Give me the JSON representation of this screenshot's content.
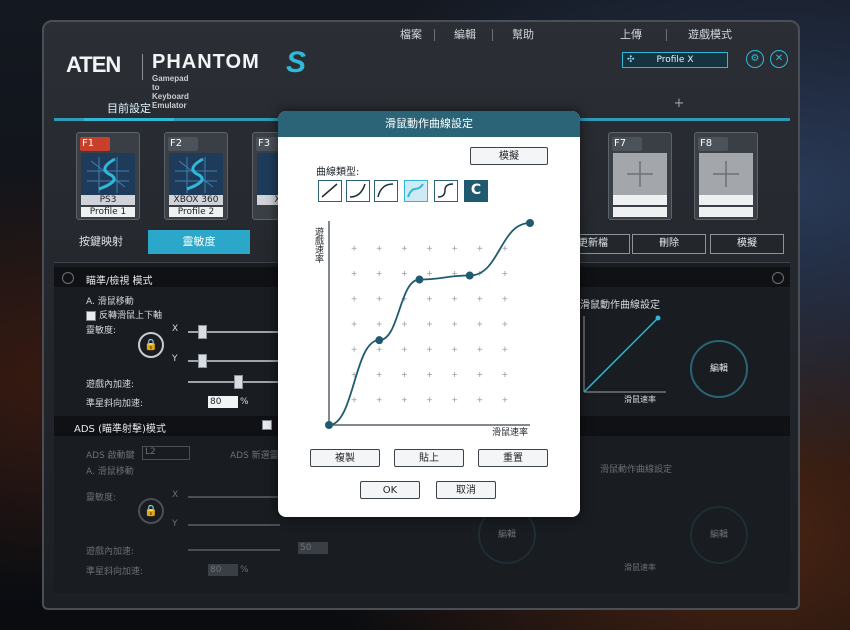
{
  "menu": {
    "file": "檔案",
    "edit": "編輯",
    "help": "幫助",
    "upload": "上傳",
    "game_mode": "遊戲模式"
  },
  "logo": {
    "brand": "ATEN",
    "product": "PHANTOM",
    "subtitle": "Gamepad to Keyboard Emulator",
    "mark": "S"
  },
  "profile_select": {
    "value": "Profile X"
  },
  "tabs": {
    "current": "目前設定",
    "add": "+"
  },
  "profiles": [
    {
      "key": "F1",
      "line1": "PS3",
      "line2": "Profile 1"
    },
    {
      "key": "F2",
      "line1": "XBOX 360",
      "line2": "Profile 2"
    },
    {
      "key": "F3",
      "line1": "XBO",
      "line2": ""
    },
    {
      "key": "F7",
      "line1": "",
      "line2": ""
    },
    {
      "key": "F8",
      "line1": "",
      "line2": ""
    }
  ],
  "nav": {
    "key_mapping": "按鍵映射",
    "sensitivity": "靈敏度"
  },
  "actions": {
    "update": "更新檔",
    "delete": "刪除",
    "simulate": "模擬"
  },
  "aim_section": {
    "title": "瞄準/檢視 模式",
    "mouse_move": "A. 滑鼠移動",
    "invert": "反轉滑鼠上下軸",
    "sensitivity": "靈敏度:",
    "x": "X",
    "y": "Y",
    "in_game_accel": "遊戲內加速:",
    "diag_accel": "準星斜向加速:",
    "diag_value": "80",
    "percent": "%",
    "curve_title": "滑鼠動作曲線設定",
    "y_axis_short": "遊戲速率",
    "x_axis": "滑鼠速率",
    "edit": "編輯"
  },
  "ads_section": {
    "title": "ADS (瞄準射擊)模式",
    "trigger": "ADS 啟動鍵",
    "trigger_value": "L2",
    "new_sens": "ADS 新選靈敏度",
    "mouse_move": "A. 滑鼠移動",
    "sensitivity": "靈敏度:",
    "x": "X",
    "y": "Y",
    "in_game_accel": "遊戲內加速:",
    "accel_value": "50",
    "diag_accel": "準星斜向加速:",
    "diag_value": "80",
    "percent": "%",
    "curve_title": "滑鼠動作曲線設定",
    "x_axis": "滑鼠速率",
    "edit": "編輯"
  },
  "modal": {
    "title": "滑鼠動作曲線設定",
    "simulate": "模擬",
    "curve_type": "曲線類型:",
    "custom_type": "C",
    "y_label": "遊戲速率",
    "x_label": "滑鼠速率",
    "copy": "複製",
    "paste": "貼上",
    "reset": "重置",
    "ok": "OK",
    "cancel": "取消"
  },
  "chart_data": {
    "type": "line",
    "x": [
      0,
      25,
      45,
      70,
      100
    ],
    "y": [
      0,
      42,
      72,
      74,
      100
    ],
    "xlabel": "滑鼠速率",
    "ylabel": "遊戲速率",
    "xlim": [
      0,
      100
    ],
    "ylim": [
      0,
      100
    ],
    "grid": "plus markers"
  },
  "colors": {
    "accent": "#2fb8d8",
    "curve": "#1f5a6e",
    "modal_header": "#2b6477"
  }
}
